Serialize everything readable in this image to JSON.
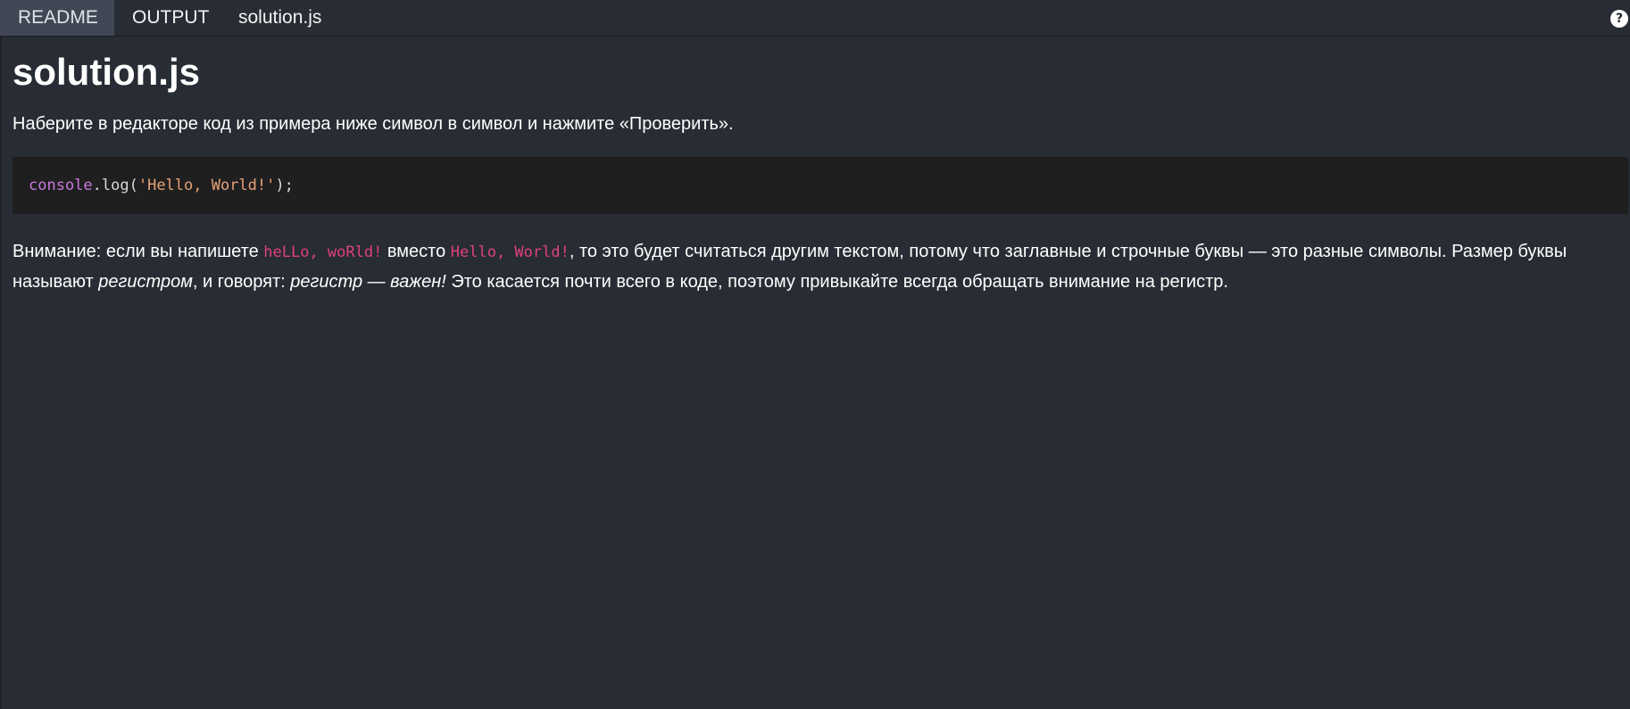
{
  "tabs": [
    {
      "label": "README",
      "active": true
    },
    {
      "label": "OUTPUT",
      "active": false
    },
    {
      "label": "solution.js",
      "active": false
    }
  ],
  "help": {
    "label": "?"
  },
  "readme": {
    "title": "solution.js",
    "intro": "Наберите в редакторе код из примера ниже символ в символ и нажмите «Проверить».",
    "code": {
      "object": "console",
      "middle": ".log(",
      "string": "'Hello, World!'",
      "end": ");"
    },
    "warning": {
      "part1": "Внимание: если вы напишете ",
      "code1": "heLLo, woRld!",
      "part2": " вместо ",
      "code2": "Hello, World!",
      "part3": ", то это будет считаться другим текстом, потому что заглавные и строчные буквы — это разные символы. Размер буквы называют ",
      "em1": "регистром",
      "part4": ", и говорят: ",
      "em2": "регистр — важен!",
      "part5": " Это касается почти всего в коде, поэтому привыкайте всегда обращать внимание на регистр."
    }
  },
  "colors": {
    "background": "#282c34",
    "active_tab": "#414754",
    "code_background": "#1f1f1f",
    "code_object": "#c678dd",
    "code_string": "#e6a278",
    "inline_code": "#e0407e"
  }
}
